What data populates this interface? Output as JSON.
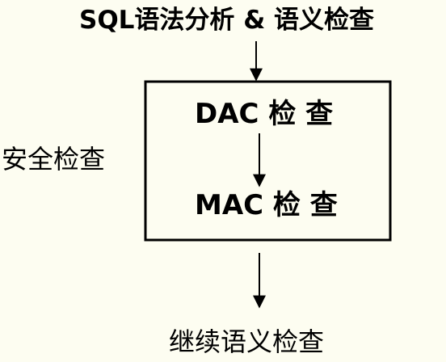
{
  "diagram": {
    "top_title": "SQL语法分析 & 语义检查",
    "box": {
      "dac_label": "DAC 检 查",
      "mac_label": "MAC 检 查"
    },
    "side_label": "安全检查",
    "bottom_label": "继续语义检查"
  },
  "colors": {
    "background": "#fdfdf1",
    "stroke": "#000000",
    "text": "#000000"
  }
}
